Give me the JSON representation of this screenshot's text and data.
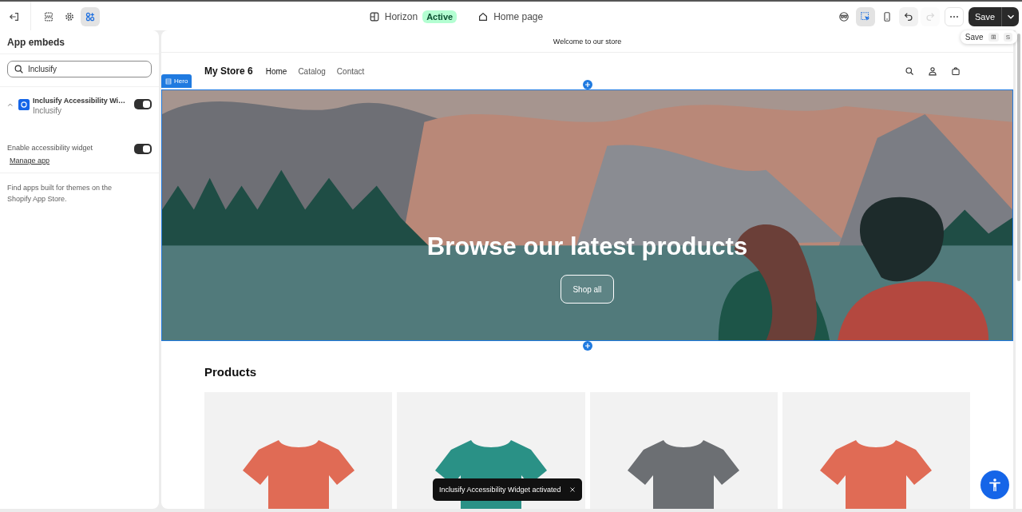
{
  "topbar": {
    "exit": {
      "kind": "exit"
    },
    "left_tools": [
      {
        "kind": "sections",
        "selected": false
      },
      {
        "kind": "settings",
        "selected": false
      },
      {
        "kind": "apps",
        "selected": true
      }
    ],
    "theme": {
      "name": "Horizon",
      "badge": "Active"
    },
    "page": "Home page",
    "view_tools": [
      {
        "kind": "preview",
        "selected": false
      },
      {
        "kind": "inspector",
        "selected": true
      },
      {
        "kind": "mobile",
        "selected": false
      }
    ],
    "history": [
      {
        "kind": "undo",
        "disabled": false
      },
      {
        "kind": "redo",
        "disabled": true
      }
    ],
    "save": "Save",
    "tooltip": {
      "label": "Save",
      "keys": [
        "⊞",
        "S"
      ]
    }
  },
  "sidebar": {
    "title": "App embeds",
    "search": {
      "value": "Inclusify"
    },
    "embeds": [
      {
        "name": "Inclusify Accessibility Wi…",
        "vendor": "Inclusify",
        "expanded": true,
        "on": true,
        "setting": {
          "label": "Enable accessibility widget",
          "on": true
        },
        "link": "Manage app"
      }
    ],
    "footer": {
      "text": "Find apps built for themes on the ",
      "link": "Shopify App Store",
      "end": "."
    }
  },
  "preview": {
    "announcement": "Welcome to our store",
    "store_name": "My Store 6",
    "nav": [
      {
        "label": "Home",
        "selected": true
      },
      {
        "label": "Catalog",
        "selected": false
      },
      {
        "label": "Contact",
        "selected": false
      }
    ],
    "hero": {
      "label": "Hero",
      "heading": "Browse our latest products",
      "button": "Shop all"
    },
    "products": {
      "title": "Products",
      "items": [
        {
          "color": "#e06b55"
        },
        {
          "color": "#2a9186"
        },
        {
          "color": "#6c6f73"
        },
        {
          "color": "#e06b55"
        }
      ]
    },
    "toast": "Inclusify Accessibility Widget activated"
  }
}
